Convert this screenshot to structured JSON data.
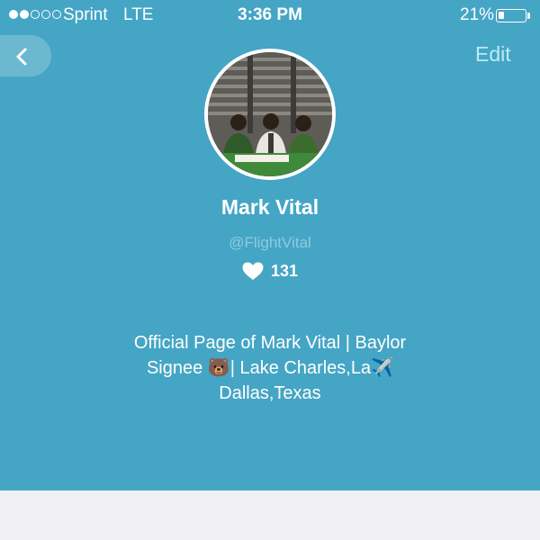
{
  "status_bar": {
    "signal_filled": 2,
    "signal_total": 5,
    "carrier": "Sprint",
    "network": "LTE",
    "time": "3:36 PM",
    "battery_percent": "21%",
    "battery_level": 0.21
  },
  "nav": {
    "back_icon": "chevron-left-icon",
    "edit_label": "Edit"
  },
  "profile": {
    "name": "Mark Vital",
    "handle": "@FlightVital",
    "likes_icon": "heart-icon",
    "likes_count": "131",
    "bio_lines": [
      "Official Page of Mark Vital | Baylor",
      "Signee 🐻| Lake Charles,La✈️",
      "Dallas,Texas"
    ]
  },
  "colors": {
    "panel_background": "#45a5c5",
    "bottom_background": "#efeff4",
    "edit_text": "#bdeaf7",
    "handle_text": "#8ccbe0"
  }
}
